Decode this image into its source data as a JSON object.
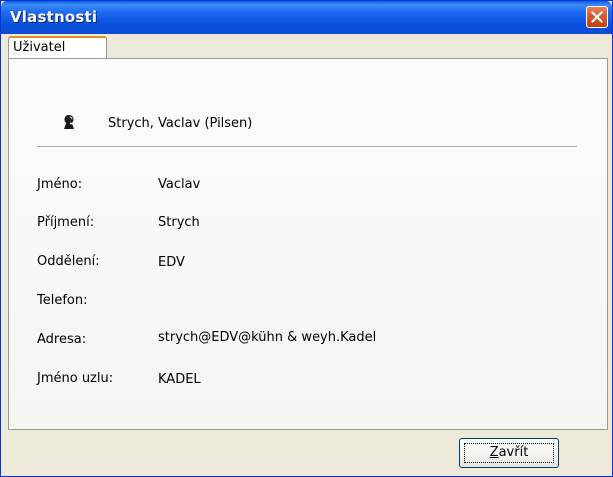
{
  "window": {
    "title": "Vlastnosti",
    "title_color": "#0a53de",
    "close_icon": "close-x-icon"
  },
  "tabs": [
    {
      "label": "Uživatel",
      "active": true
    }
  ],
  "user": {
    "icon": "user-icon",
    "display_name": "Strych, Vaclav (Pilsen)"
  },
  "fields": [
    {
      "label": "Jméno:",
      "value": "Vaclav"
    },
    {
      "label": "Příjmení:",
      "value": "Strych"
    },
    {
      "label": "Oddělení:",
      "value": "EDV"
    },
    {
      "label": "Telefon:",
      "value": ""
    },
    {
      "label": "Adresa:",
      "value": "strych@EDV@kühn & weyh.Kadel"
    },
    {
      "label": "Jméno uzlu:",
      "value": "KADEL"
    }
  ],
  "buttons": {
    "close_label_prefix": "Z",
    "close_label_rest": "avřít"
  }
}
